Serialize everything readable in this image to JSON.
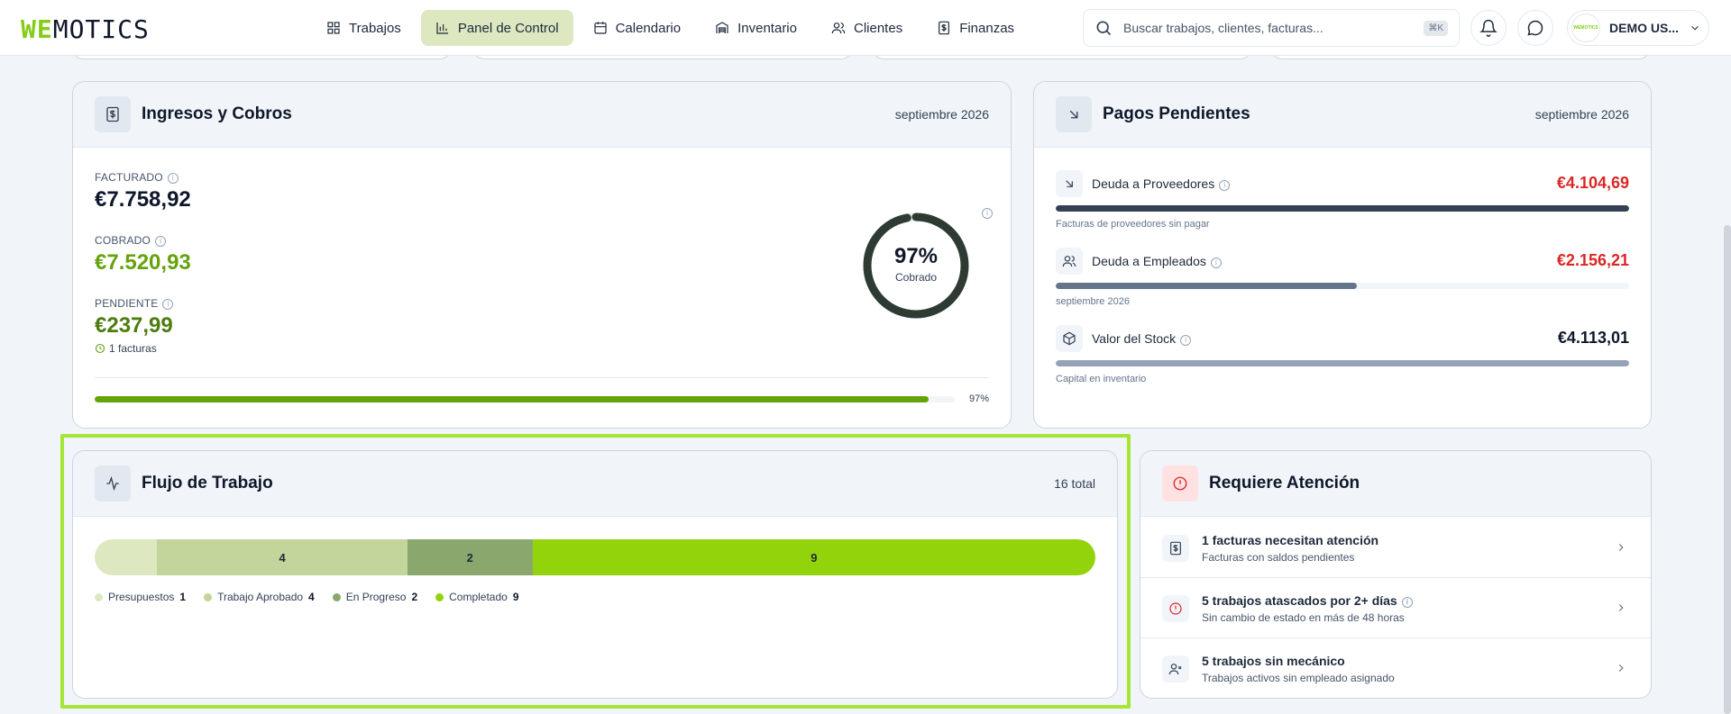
{
  "brand": {
    "logo_we": "WE",
    "logo_rest": "MOTICS",
    "accent": "#84cc16"
  },
  "nav": {
    "items": [
      {
        "label": "Trabajos",
        "icon": "grid-icon",
        "active": false
      },
      {
        "label": "Panel de Control",
        "icon": "bar-chart-icon",
        "active": true
      },
      {
        "label": "Calendario",
        "icon": "calendar-icon",
        "active": false
      },
      {
        "label": "Inventario",
        "icon": "warehouse-icon",
        "active": false
      },
      {
        "label": "Clientes",
        "icon": "users-icon",
        "active": false
      },
      {
        "label": "Finanzas",
        "icon": "dollar-file-icon",
        "active": false
      }
    ]
  },
  "search": {
    "placeholder": "Buscar trabajos, clientes, facturas...",
    "shortcut": "⌘K"
  },
  "user": {
    "name": "DEMO US...",
    "avatar_text": "WEMOTICS"
  },
  "ingresos": {
    "title": "Ingresos y Cobros",
    "period": "septiembre 2026",
    "facturado_label": "FACTURADO",
    "facturado_value": "€7.758,92",
    "cobrado_label": "COBRADO",
    "cobrado_value": "€7.520,93",
    "pendiente_label": "PENDIENTE",
    "pendiente_value": "€237,99",
    "pendiente_note": "1 facturas",
    "ring_percent_text": "97%",
    "ring_caption": "Cobrado",
    "progress_text": "97%",
    "progress_fraction": 0.97
  },
  "pagos": {
    "title": "Pagos Pendientes",
    "period": "septiembre 2026",
    "rows": [
      {
        "label": "Deuda a Proveedores",
        "value": "€4.104,69",
        "sub": "Facturas de proveedores sin pagar",
        "fraction": 1.0,
        "bar_color": "#334155",
        "value_color": "#dc2626",
        "icon": "arrow-down-right-icon"
      },
      {
        "label": "Deuda a Empleados",
        "value": "€2.156,21",
        "sub": "septiembre 2026",
        "fraction": 0.525,
        "bar_color": "#64748b",
        "value_color": "#dc2626",
        "icon": "users-icon"
      },
      {
        "label": "Valor del Stock",
        "value": "€4.113,01",
        "sub": "Capital en inventario",
        "fraction": 1.0,
        "bar_color": "#94a3b8",
        "value_color": "#0f172a",
        "icon": "box-icon"
      }
    ]
  },
  "flujo": {
    "title": "Flujo de Trabajo",
    "total": "16 total",
    "segments": [
      {
        "name": "Presupuestos",
        "count": 1,
        "color": "#dde8c0",
        "show_label": false
      },
      {
        "name": "Trabajo Aprobado",
        "count": 4,
        "color": "#c2d59a",
        "show_label": true
      },
      {
        "name": "En Progreso",
        "count": 2,
        "color": "#8aa86e",
        "show_label": true
      },
      {
        "name": "Completado",
        "count": 9,
        "color": "#93d30b",
        "show_label": true
      }
    ]
  },
  "atencion": {
    "title": "Requiere Atención",
    "items": [
      {
        "title": "1 facturas necesitan atención",
        "sub": "Facturas con saldos pendientes",
        "icon": "dollar-file-icon",
        "info": false
      },
      {
        "title": "5 trabajos atascados por 2+ días",
        "sub": "Sin cambio de estado en más de 48 horas",
        "icon": "alert-circle-icon",
        "info": true
      },
      {
        "title": "5 trabajos sin mecánico",
        "sub": "Trabajos activos sin empleado asignado",
        "icon": "user-x-icon",
        "info": false
      }
    ]
  }
}
